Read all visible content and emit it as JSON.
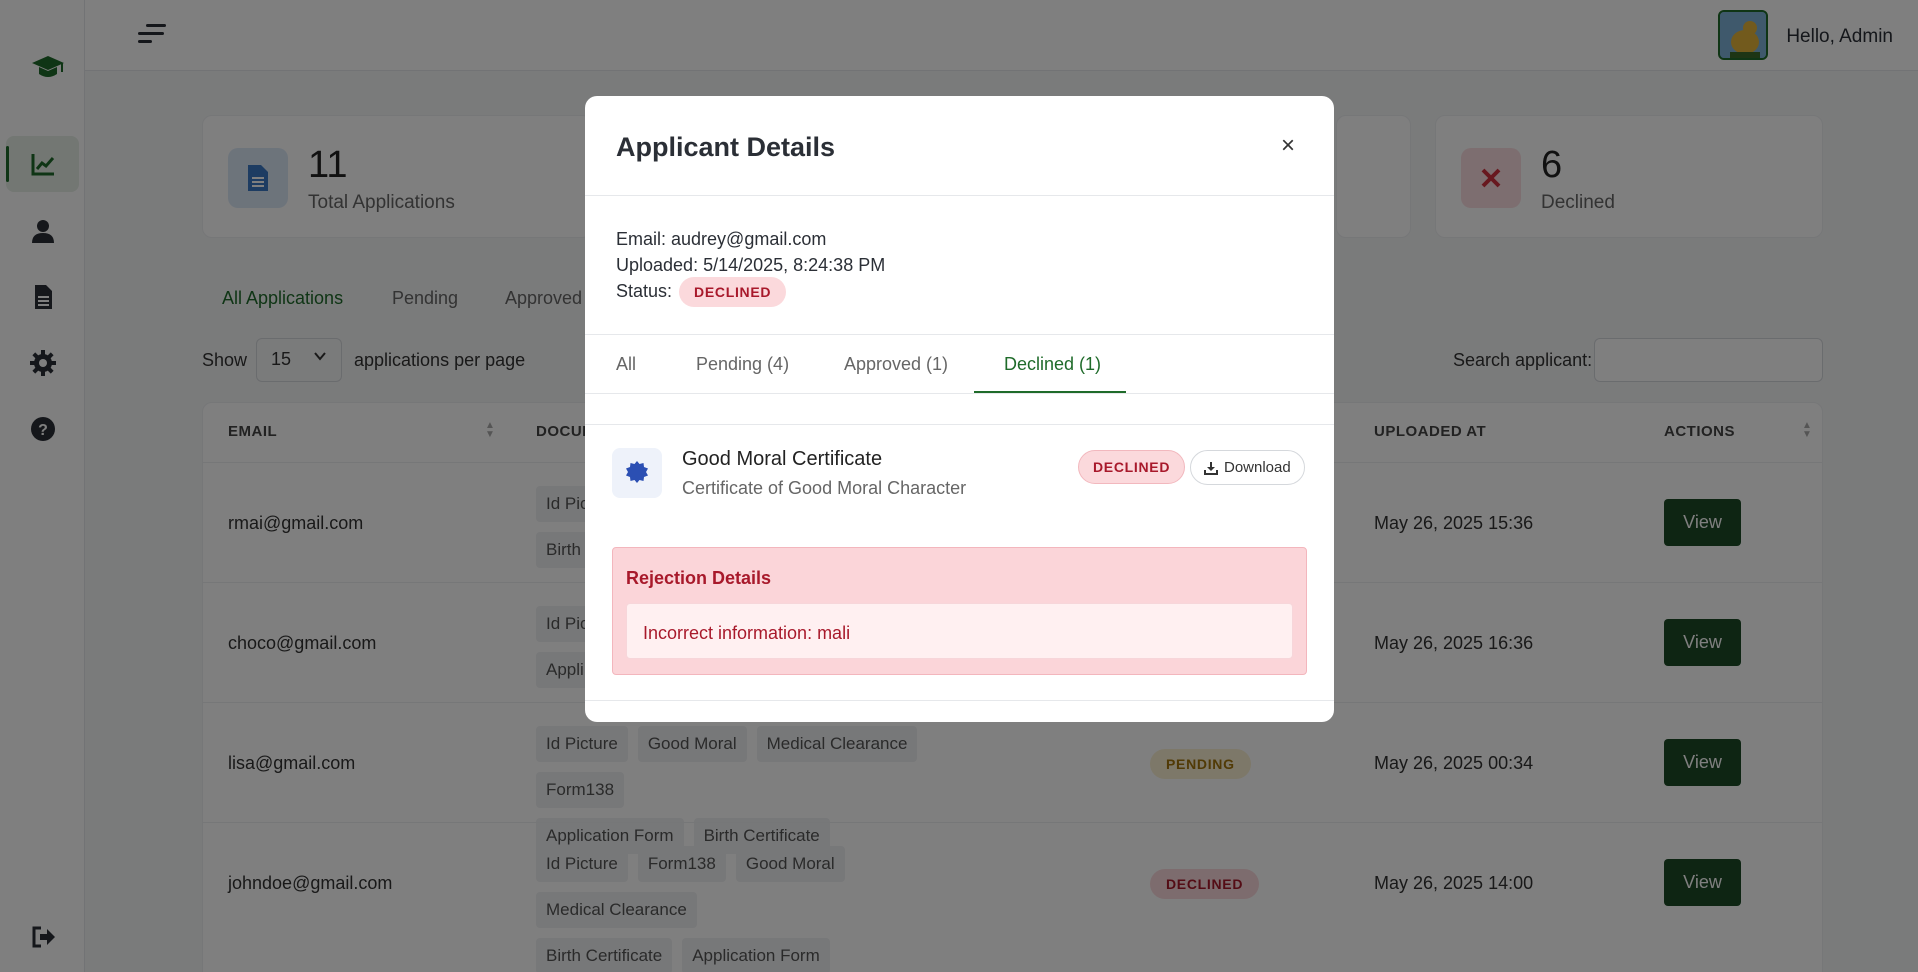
{
  "header": {
    "greeting": "Hello, Admin"
  },
  "sidebar": {
    "items": [
      {
        "icon": "chart-line-icon"
      },
      {
        "icon": "user-icon"
      },
      {
        "icon": "document-icon"
      },
      {
        "icon": "gear-icon"
      },
      {
        "icon": "help-icon"
      }
    ],
    "bottom_icon": "logout-icon"
  },
  "stats": {
    "total": {
      "value": "11",
      "label": "Total Applications"
    },
    "declined": {
      "value": "6",
      "label": "Declined"
    }
  },
  "filter_tabs": [
    "All Applications",
    "Pending",
    "Approved"
  ],
  "controls": {
    "show_label": "Show",
    "per_page_value": "15",
    "per_page_label": "applications per page",
    "search_label": "Search applicant:"
  },
  "table": {
    "headers": {
      "email": "EMAIL",
      "documents": "DOCUM",
      "uploaded_at": "UPLOADED AT",
      "actions": "ACTIONS"
    },
    "rows": [
      {
        "email": "rmai@gmail.com",
        "documents": [
          "Id Pic",
          "Birth"
        ],
        "status": "",
        "uploaded_at": "May 26, 2025 15:36",
        "action": "View"
      },
      {
        "email": "choco@gmail.com",
        "documents": [
          "Id Pic",
          "Appli"
        ],
        "status": "",
        "uploaded_at": "May 26, 2025 16:36",
        "action": "View"
      },
      {
        "email": "lisa@gmail.com",
        "documents": [
          "Id Picture",
          "Good Moral",
          "Medical Clearance",
          "Form138",
          "Application Form",
          "Birth Certificate"
        ],
        "status": "PENDING",
        "uploaded_at": "May 26, 2025 00:34",
        "action": "View"
      },
      {
        "email": "johndoe@gmail.com",
        "documents": [
          "Id Picture",
          "Form138",
          "Good Moral",
          "Medical Clearance",
          "Birth Certificate",
          "Application Form"
        ],
        "status": "DECLINED",
        "uploaded_at": "May 26, 2025 14:00",
        "action": "View"
      }
    ]
  },
  "modal": {
    "title": "Applicant Details",
    "close": "×",
    "email_line": "Email: audrey@gmail.com",
    "uploaded_line": "Uploaded: 5/14/2025, 8:24:38 PM",
    "status_label": "Status:",
    "status_value": "DECLINED",
    "tabs": [
      "All",
      "Pending (4)",
      "Approved (1)",
      "Declined (1)"
    ],
    "document": {
      "name": "Good Moral Certificate",
      "description": "Certificate of Good Moral Character",
      "status": "DECLINED",
      "download_label": "Download"
    },
    "rejection": {
      "title": "Rejection Details",
      "reason": "Incorrect information: mali"
    }
  }
}
